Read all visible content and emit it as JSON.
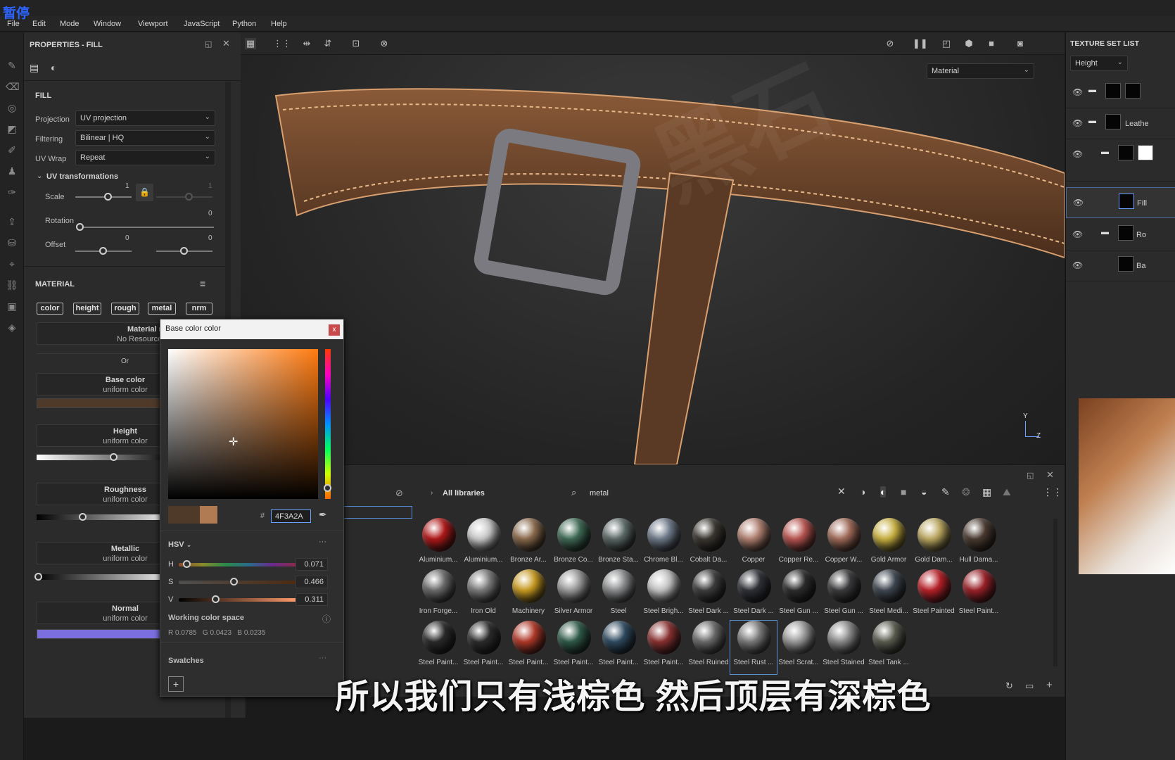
{
  "overlay_tag": "暂停",
  "menu": [
    "File",
    "Edit",
    "Mode",
    "Window",
    "Viewport",
    "JavaScript",
    "Python",
    "Help"
  ],
  "properties": {
    "title": "PROPERTIES - FILL",
    "fill_heading": "FILL",
    "projection_label": "Projection",
    "projection_value": "UV projection",
    "filtering_label": "Filtering",
    "filtering_value": "Bilinear | HQ",
    "uvwrap_label": "UV Wrap",
    "uvwrap_value": "Repeat",
    "uv_transform_heading": "UV transformations",
    "scale_label": "Scale",
    "scale_value": "1",
    "scale_value2": "1",
    "rotation_label": "Rotation",
    "rotation_value": "0",
    "offset_label": "Offset",
    "offset_value": "0",
    "offset_value2": "0",
    "material_heading": "MATERIAL",
    "chips": [
      "color",
      "height",
      "rough",
      "metal",
      "nrm"
    ],
    "material_mode_title": "Material mode",
    "material_mode_sub": "No Resource Selecte",
    "or_label": "Or",
    "channels": [
      {
        "title": "Base color",
        "sub": "uniform color"
      },
      {
        "title": "Height",
        "sub": "uniform color"
      },
      {
        "title": "Roughness",
        "sub": "uniform color"
      },
      {
        "title": "Metallic",
        "sub": "uniform color"
      },
      {
        "title": "Normal",
        "sub": "uniform color"
      }
    ],
    "base_color_swatch": "#4F3A2A",
    "normal_swatch": "#7b6fe0"
  },
  "color_picker": {
    "title": "Base color color",
    "close": "x",
    "hex_prefix": "#",
    "hex_value": "4F3A2A",
    "previous_color": "#4F3A2A",
    "current_color": "#b07a52",
    "mode_label": "HSV",
    "h_label": "H",
    "h_value": "0.071",
    "s_label": "S",
    "s_value": "0.466",
    "v_label": "V",
    "v_value": "0.311",
    "working_space_label": "Working color space",
    "rgb_readout": "R 0.0785   G 0.0423   B 0.0235",
    "swatches_label": "Swatches",
    "more": "···",
    "add": "+"
  },
  "viewport": {
    "material_dropdown": "Material",
    "axis_y": "Y",
    "axis_z": "Z"
  },
  "texture_set_list": {
    "title": "TEXTURE SET LIST",
    "channel_dropdown": "Height",
    "layers": [
      {
        "name": "",
        "has_folder": true
      },
      {
        "name": "Leathe",
        "has_folder": true
      },
      {
        "name": "",
        "has_folder": true
      },
      {
        "name": "Fill",
        "has_folder": false
      },
      {
        "name": "Ro",
        "has_folder": true
      },
      {
        "name": "Ba",
        "has_folder": false
      }
    ]
  },
  "shelf": {
    "library_label": "All libraries",
    "search_value": "metal",
    "materials": [
      {
        "name": "Aluminium...",
        "color": "#b01818"
      },
      {
        "name": "Aluminium...",
        "color": "#c8c8c8"
      },
      {
        "name": "Bronze Ar...",
        "color": "#8a6a4c"
      },
      {
        "name": "Bronze Co...",
        "color": "#3e6a55"
      },
      {
        "name": "Bronze Sta...",
        "color": "#5c6a68"
      },
      {
        "name": "Chrome Bl...",
        "color": "#6e7a8a"
      },
      {
        "name": "Cobalt Da...",
        "color": "#3a3630"
      },
      {
        "name": "Copper",
        "color": "#b08070"
      },
      {
        "name": "Copper Re...",
        "color": "#b85450"
      },
      {
        "name": "Copper W...",
        "color": "#a06a58"
      },
      {
        "name": "Gold Armor",
        "color": "#c8b040"
      },
      {
        "name": "Gold Dam...",
        "color": "#bca860"
      },
      {
        "name": "Hull Dama...",
        "color": "#4a3a30"
      },
      {
        "name": "Iron Forge...",
        "color": "#6a6a6a"
      },
      {
        "name": "Iron Old",
        "color": "#7a7a7a"
      },
      {
        "name": "Machinery",
        "color": "#c89a20"
      },
      {
        "name": "Silver Armor",
        "color": "#9a9a9a"
      },
      {
        "name": "Steel",
        "color": "#8a8c8e"
      },
      {
        "name": "Steel Brigh...",
        "color": "#c2c2c2"
      },
      {
        "name": "Steel Dark ...",
        "color": "#3c3c3c"
      },
      {
        "name": "Steel Dark ...",
        "color": "#2e3036"
      },
      {
        "name": "Steel Gun ...",
        "color": "#2c2c2c"
      },
      {
        "name": "Steel Gun ...",
        "color": "#3a3a3c"
      },
      {
        "name": "Steel Medi...",
        "color": "#3e4650"
      },
      {
        "name": "Steel Painted",
        "color": "#b82028"
      },
      {
        "name": "Steel Paint...",
        "color": "#9a2028"
      },
      {
        "name": "Steel Paint...",
        "color": "#2a2a2a"
      },
      {
        "name": "Steel Paint...",
        "color": "#2c2c2c"
      },
      {
        "name": "Steel Paint...",
        "color": "#b03828"
      },
      {
        "name": "Steel Paint...",
        "color": "#2e5a48"
      },
      {
        "name": "Steel Paint...",
        "color": "#2e4a60"
      },
      {
        "name": "Steel Paint...",
        "color": "#8a3030"
      },
      {
        "name": "Steel Ruined",
        "color": "#6a6a6a"
      },
      {
        "name": "Steel Rust ...",
        "color": "#7a7a7a"
      },
      {
        "name": "Steel Scrat...",
        "color": "#9a9a9a"
      },
      {
        "name": "Steel Stained",
        "color": "#8a8a8a"
      },
      {
        "name": "Steel Tank ...",
        "color": "#5a5c50"
      }
    ]
  },
  "subtitle": "所以我们只有浅棕色 然后顶层有深棕色"
}
